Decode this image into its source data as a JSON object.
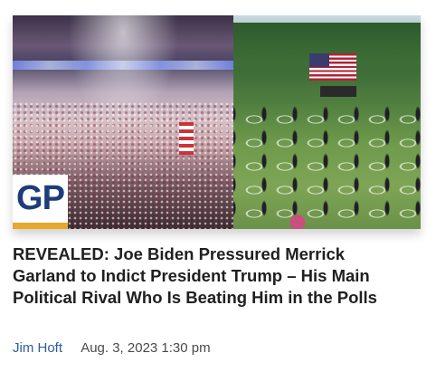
{
  "article": {
    "headline": "REVEALED: Joe Biden Pressured Merrick Garland to Indict President Trump – His Main Political Rival Who Is Beating Him in the Polls",
    "author": "Jim Hoft",
    "date": "Aug. 3, 2023 1:30 pm"
  },
  "logo": {
    "text": "GP",
    "text_color": "#1d3d7a",
    "bar_color": "#e6a92c"
  },
  "colors": {
    "author_link": "#2f5c9b",
    "headline": "#202020",
    "date": "#4a4a4a"
  }
}
